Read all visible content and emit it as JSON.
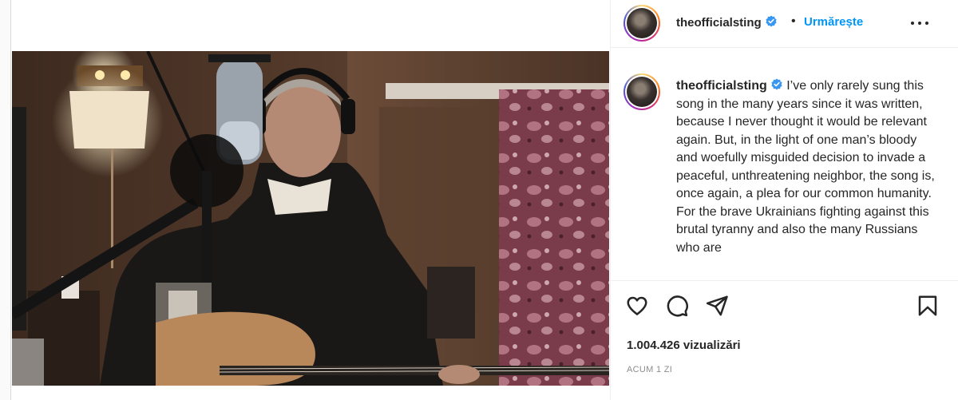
{
  "post": {
    "username": "theofficialsting",
    "verified": true,
    "separator": "•",
    "follow_label": "Urmărește",
    "more_icon": "more-horizontal-icon",
    "caption": "I’ve only rarely sung this song in the many years since it was written, because I never thought it would be relevant again. But, in the light of one man’s bloody and woefully misguided decision to invade a peaceful, unthreatening neighbor, the song is, once again, a plea for our common humanity. For the brave Ukrainians fighting against this brutal tyranny and also the many Russians who are",
    "views": "1.004.426 vizualizări",
    "timestamp": "ACUM 1 ZI"
  },
  "actions": {
    "like_icon": "heart-icon",
    "comment_icon": "comment-icon",
    "share_icon": "paper-plane-icon",
    "save_icon": "bookmark-icon"
  },
  "colors": {
    "link_blue": "#0095f6",
    "verified_blue": "#3897f0",
    "text": "#262626",
    "muted": "#8e8e8e",
    "divider": "#efefef"
  }
}
